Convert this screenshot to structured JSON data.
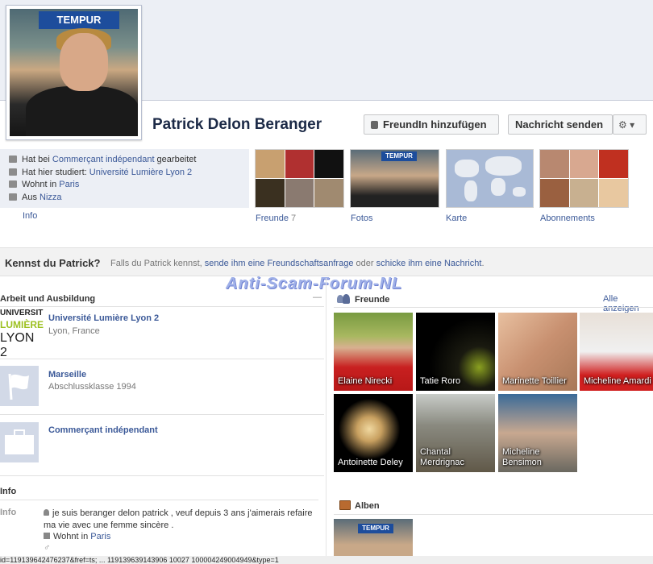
{
  "profile": {
    "name": "Patrick Delon Beranger",
    "photo_banner": "TEMPUR"
  },
  "actions": {
    "add_friend": "FreundIn hinzufügen",
    "send_message": "Nachricht senden",
    "gear": "⚙ ▾"
  },
  "info": {
    "work_prefix": "Hat bei ",
    "work_link": "Commerçant indépendant",
    "work_suffix": " gearbeitet",
    "study_prefix": "Hat hier studiert: ",
    "study_link": "Université Lumière Lyon 2",
    "lives_prefix": "Wohnt in ",
    "lives_link": "Paris",
    "from_prefix": "Aus ",
    "from_link": "Nizza",
    "info_link": "Info"
  },
  "tiles": {
    "friends_label": "Freunde",
    "friends_count": "7",
    "photos_label": "Fotos",
    "map_label": "Karte",
    "subs_label": "Abonnements"
  },
  "kennst": {
    "question": "Kennst du Patrick?",
    "text_prefix": "Falls du Patrick kennst, ",
    "link1": "sende ihm eine Freundschaftsanfrage",
    "mid": " oder ",
    "link2": "schicke ihm eine Nachricht",
    "end": "."
  },
  "watermark": "Anti-Scam-Forum-NL",
  "work_edu": {
    "title": "Arbeit und Ausbildung",
    "collapse": "—",
    "logo_text": [
      "UNIVERSIT",
      "LUMIÈRE",
      "LYON 2"
    ],
    "items": [
      {
        "title": "Université Lumière Lyon 2",
        "sub": "Lyon, France"
      },
      {
        "title": "Marseille",
        "sub": "Abschlussklasse 1994"
      },
      {
        "title": "Commerçant indépendant",
        "sub": ""
      }
    ]
  },
  "friends": {
    "title": "Freunde",
    "see_all": "Alle anzeigen",
    "list": [
      {
        "name": "Elaine Nirecki"
      },
      {
        "name": "Tatie Roro"
      },
      {
        "name": "Marinette Toillier"
      },
      {
        "name": "Micheline Amardi"
      },
      {
        "name": "Antoinette Deley"
      },
      {
        "name": "Chantal\nMerdrignac"
      },
      {
        "name": "Micheline\nBensimon"
      }
    ]
  },
  "about": {
    "title": "Info",
    "label": "Info",
    "bio": "je suis beranger delon patrick , veuf depuis 3 ans j'aimerais refaire ma vie avec une femme sincère .",
    "lives_prefix": "Wohnt in ",
    "lives_link": "Paris",
    "gender_icon": "♂"
  },
  "albums": {
    "title": "Alben",
    "thumb_banner": "TEMPUR"
  },
  "status_bar": "id=119139642476237&fref=ts; ... 119139639143906 10027 100004249004949&type=1"
}
